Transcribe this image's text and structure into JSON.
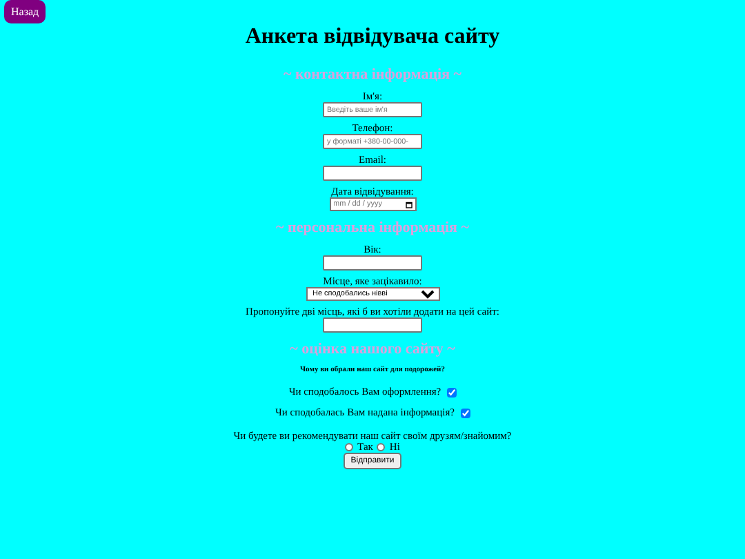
{
  "back_button": "Назад",
  "title": "Анкета відвідувача сайту",
  "sections": [
    {
      "heading": "~ контактна інформація ~",
      "fields": [
        {
          "kind": "text",
          "label": "Ім'я:",
          "placeholder": "Введіть ваше ім'я"
        },
        {
          "kind": "text",
          "label": "Телефон:",
          "placeholder": "у форматі +380-00-000-"
        },
        {
          "kind": "text",
          "label": "Email:"
        },
        {
          "kind": "date",
          "label": "Дата відвідування:",
          "placeholder": "mm / dd / yyyy"
        }
      ]
    },
    {
      "heading": "~ персональна інформація ~",
      "fields": [
        {
          "kind": "text",
          "label": "Вік:"
        },
        {
          "kind": "select",
          "label": "Місце, яке зацікавило:",
          "value": "Не сподобались нівві"
        },
        {
          "kind": "text",
          "label": "Пропонуйте дві місць, які б ви хотіли додати на цей сайт:"
        }
      ]
    },
    {
      "heading": "~ оцінка нашого сайту ~",
      "fields": [
        {
          "kind": "note",
          "label": "Чому ви обрали наш сайт для подорожей?"
        },
        {
          "kind": "checkbox",
          "label": "Чи сподобалось Вам оформлення?",
          "checked": true
        },
        {
          "kind": "checkbox",
          "label": "Чи сподобалась Вам надана інформація?",
          "checked": true
        },
        {
          "kind": "radio",
          "label": "Чи будете ви рекомендувати наш сайт своїм друзям/знайомим?",
          "options": [
            {
              "label": "Так",
              "selected": false
            },
            {
              "label": "Ні",
              "selected": false
            }
          ]
        }
      ]
    }
  ],
  "submit": "Відправити"
}
